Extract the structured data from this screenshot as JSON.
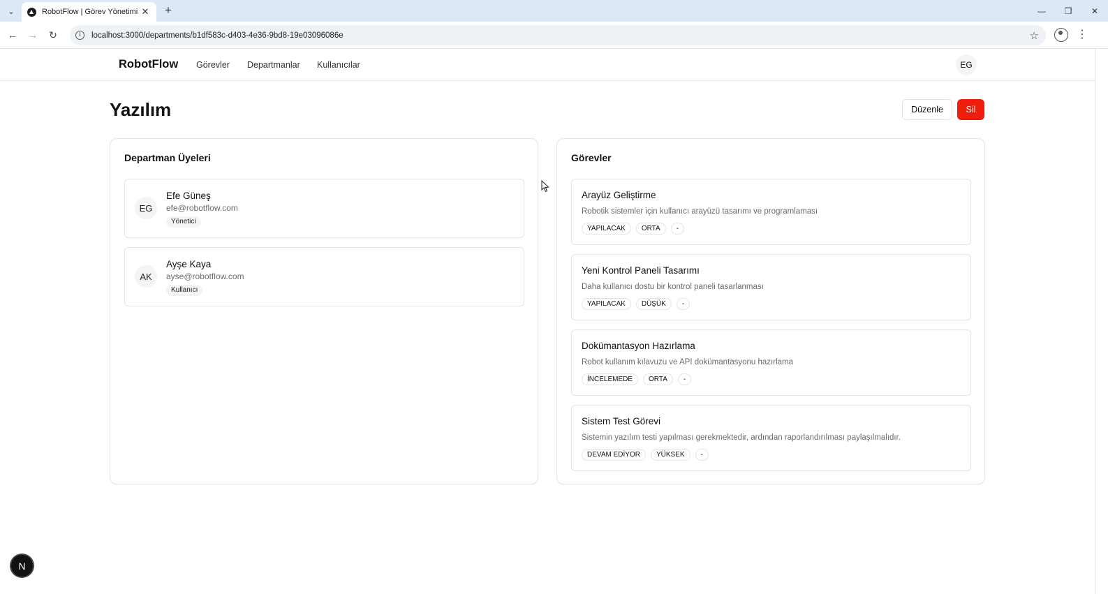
{
  "browser": {
    "tab_title": "RobotFlow | Görev Yönetimi",
    "url": "localhost:3000/departments/b1df583c-d403-4e36-9bd8-19e03096086e"
  },
  "header": {
    "brand": "RobotFlow",
    "nav": [
      "Görevler",
      "Departmanlar",
      "Kullanıcılar"
    ],
    "user_initials": "EG"
  },
  "page": {
    "title": "Yazılım",
    "edit_label": "Düzenle",
    "delete_label": "Sil"
  },
  "members": {
    "title": "Departman Üyeleri",
    "items": [
      {
        "initials": "EG",
        "name": "Efe Güneş",
        "email": "efe@robotflow.com",
        "role": "Yönetici"
      },
      {
        "initials": "AK",
        "name": "Ayşe Kaya",
        "email": "ayse@robotflow.com",
        "role": "Kullanıcı"
      }
    ]
  },
  "tasks": {
    "title": "Görevler",
    "items": [
      {
        "title": "Arayüz Geliştirme",
        "description": "Robotik sistemler için kullanıcı arayüzü tasarımı ve programlaması",
        "status": "YAPILACAK",
        "priority": "ORTA",
        "extra": "-"
      },
      {
        "title": "Yeni Kontrol Paneli Tasarımı",
        "description": "Daha kullanıcı dostu bir kontrol paneli tasarlanması",
        "status": "YAPILACAK",
        "priority": "DÜŞÜK",
        "extra": "-"
      },
      {
        "title": "Dokümantasyon Hazırlama",
        "description": "Robot kullanım kılavuzu ve API dokümantasyonu hazırlama",
        "status": "İNCELEMEDE",
        "priority": "ORTA",
        "extra": "-"
      },
      {
        "title": "Sistem Test Görevi",
        "description": "Sistemin yazılım testi yapılması gerekmektedir, ardından raporlandırılması paylaşılmalıdır.",
        "status": "DEVAM EDİYOR",
        "priority": "YÜKSEK",
        "extra": "-"
      }
    ]
  },
  "dev_badge": "N",
  "colors": {
    "tabbar": "#dde8f7",
    "danger": "#f01c0c",
    "border": "#e4e4e7",
    "muted_text": "#6b6b6b"
  },
  "icons": [
    "tab-dropdown-icon",
    "favicon-icon",
    "close-icon",
    "plus-icon",
    "minimize-icon",
    "restore-icon",
    "window-close-icon",
    "back-icon",
    "forward-icon",
    "reload-icon",
    "info-icon",
    "star-icon",
    "profile-icon",
    "kebab-icon",
    "cursor-icon"
  ]
}
